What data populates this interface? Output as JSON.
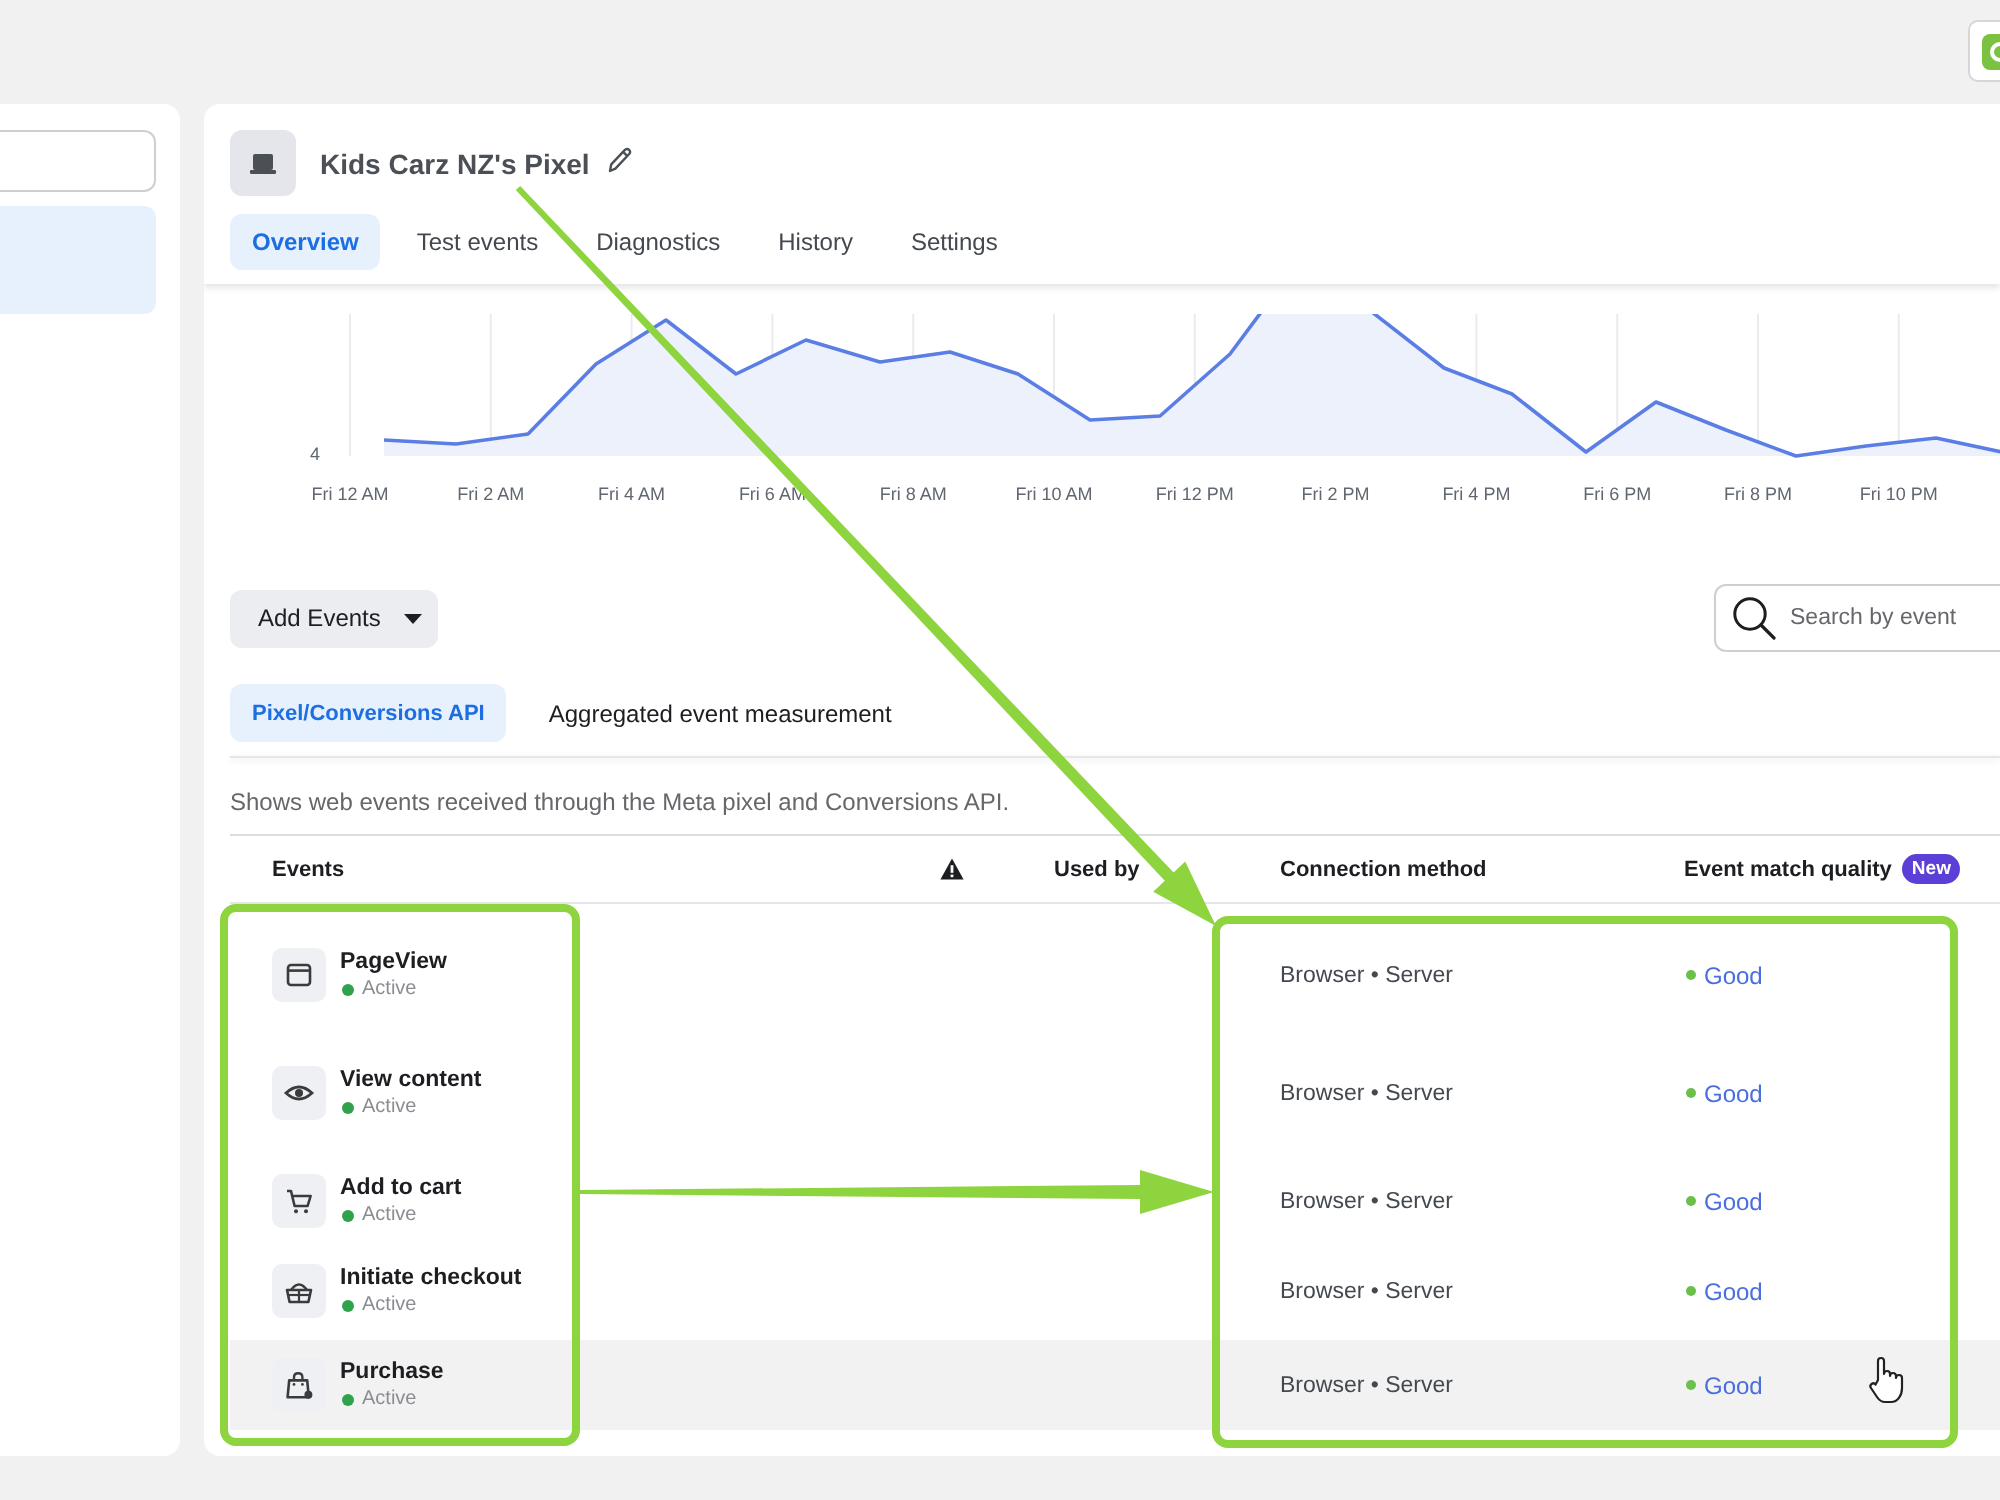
{
  "sidebar": {
    "items": [
      {
        "selected": true
      }
    ]
  },
  "pixel": {
    "title": "Kids Carz NZ's Pixel",
    "tabs": [
      {
        "label": "Overview",
        "selected": true
      },
      {
        "label": "Test events",
        "selected": false
      },
      {
        "label": "Diagnostics",
        "selected": false
      },
      {
        "label": "History",
        "selected": false
      },
      {
        "label": "Settings",
        "selected": false
      }
    ]
  },
  "chart": {
    "y_tick": "4",
    "x_labels": [
      "Fri 12 AM",
      "Fri 2 AM",
      "Fri 4 AM",
      "Fri 6 AM",
      "Fri 8 AM",
      "Fri 10 AM",
      "Fri 12 PM",
      "Fri 2 PM",
      "Fri 4 PM",
      "Fri 6 PM",
      "Fri 8 PM",
      "Fri 10 PM"
    ]
  },
  "toolbar": {
    "add_button": "Add Events",
    "search": {
      "placeholder": "Search by event"
    }
  },
  "sub_tabs": [
    {
      "label": "Pixel/Conversions API",
      "selected": true
    },
    {
      "label": "Aggregated event measurement",
      "selected": false
    }
  ],
  "description": "Shows web events received through the Meta pixel and Conversions API.",
  "table": {
    "columns": [
      {
        "kind": "text",
        "label": "Events"
      },
      {
        "kind": "icon"
      },
      {
        "kind": "text",
        "label": "Used by"
      },
      {
        "kind": "text",
        "label": "Connection method"
      },
      {
        "kind": "text",
        "label": "Event match quality",
        "badge": "New"
      }
    ],
    "rows": [
      {
        "name": "PageView",
        "status": "Active",
        "connection": "Browser • Server",
        "quality": "Good",
        "hovered": false
      },
      {
        "name": "View content",
        "status": "Active",
        "connection": "Browser • Server",
        "quality": "Good",
        "hovered": false
      },
      {
        "name": "Add to cart",
        "status": "Active",
        "connection": "Browser • Server",
        "quality": "Good",
        "hovered": false
      },
      {
        "name": "Initiate checkout",
        "status": "Active",
        "connection": "Browser • Server",
        "quality": "Good",
        "hovered": false
      },
      {
        "name": "Purchase",
        "status": "Active",
        "connection": "Browser • Server",
        "quality": "Good",
        "hovered": true
      }
    ]
  }
}
